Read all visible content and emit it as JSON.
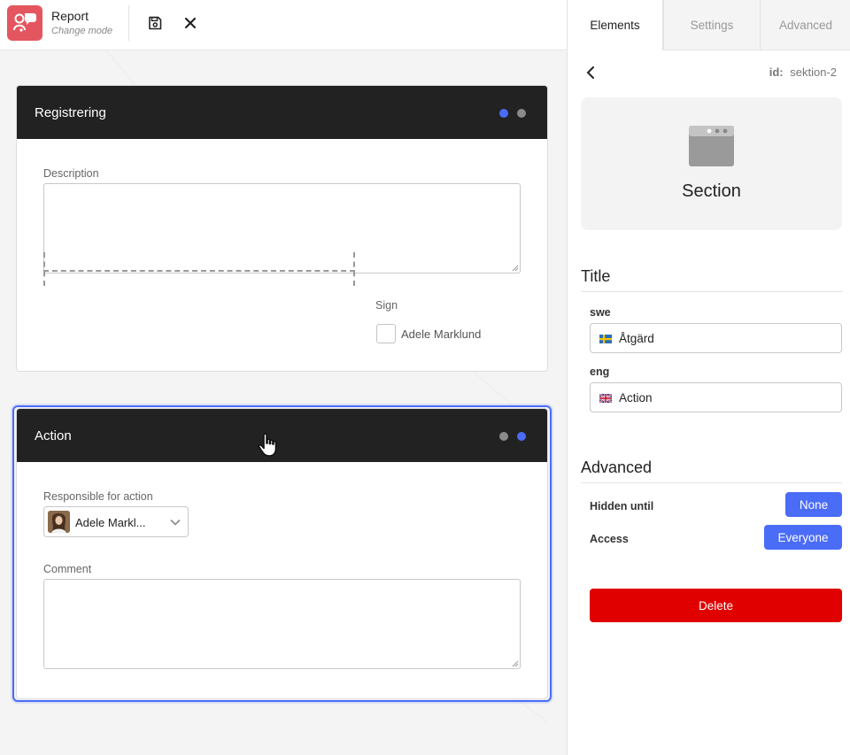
{
  "app": {
    "title": "Report",
    "mode": "Change mode"
  },
  "canvas": {
    "card_registrering": {
      "title": "Registrering",
      "description_label": "Description",
      "sign_label": "Sign",
      "sign_user": "Adele Marklund"
    },
    "card_action": {
      "title": "Action",
      "responsible_label": "Responsible for action",
      "responsible_user": "Adele Markl...",
      "comment_label": "Comment"
    }
  },
  "panel": {
    "tabs": [
      {
        "label": "Elements",
        "active": true
      },
      {
        "label": "Settings",
        "active": false
      },
      {
        "label": "Advanced",
        "active": false
      }
    ],
    "id_label": "id:",
    "id_value": "sektion-2",
    "element_type": "Section",
    "title_section": "Title",
    "languages": [
      {
        "code": "swe",
        "value": "Åtgärd",
        "flag": "swedish-flag-icon"
      },
      {
        "code": "eng",
        "value": "Action",
        "flag": "uk-flag-icon"
      }
    ],
    "advanced_section": "Advanced",
    "hidden_until_label": "Hidden until",
    "hidden_until_value": "None",
    "access_label": "Access",
    "access_value": "Everyone",
    "delete_label": "Delete"
  },
  "colors": {
    "accent": "#4a6cf7",
    "header_dark": "#222223",
    "logo": "#e4565f",
    "danger": "#e00000"
  }
}
